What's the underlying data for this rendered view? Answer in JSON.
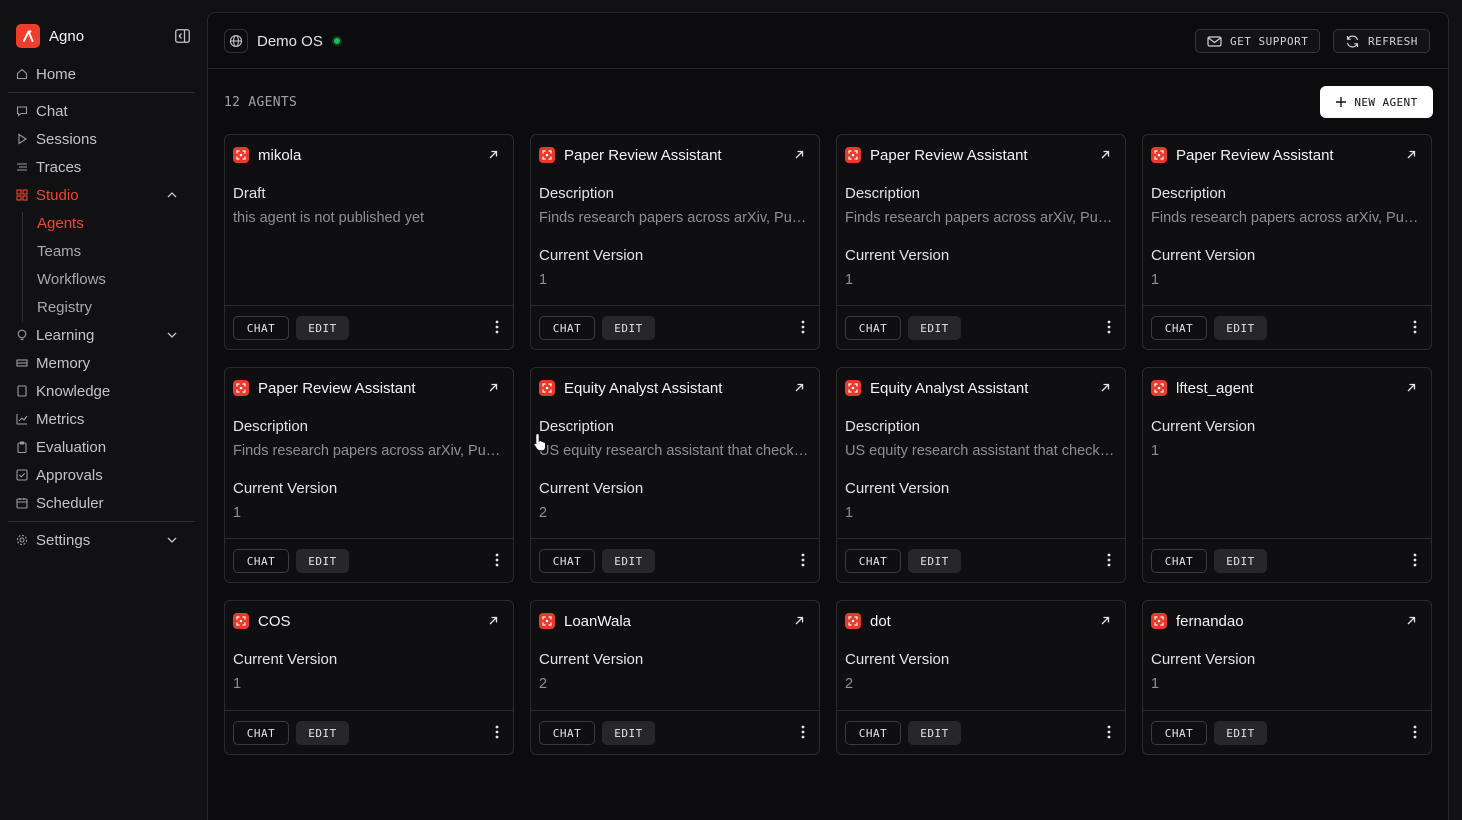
{
  "sidebar": {
    "brand": "Agno",
    "nav": {
      "home": "Home",
      "chat": "Chat",
      "sessions": "Sessions",
      "traces": "Traces",
      "studio": "Studio",
      "agents": "Agents",
      "teams": "Teams",
      "workflows": "Workflows",
      "registry": "Registry",
      "learning": "Learning",
      "memory": "Memory",
      "knowledge": "Knowledge",
      "metrics": "Metrics",
      "evaluation": "Evaluation",
      "approvals": "Approvals",
      "scheduler": "Scheduler",
      "settings": "Settings"
    }
  },
  "header": {
    "os_name": "Demo OS",
    "status_color": "#1db954",
    "support_label": "GET SUPPORT",
    "refresh_label": "REFRESH"
  },
  "main": {
    "count_label": "12 AGENTS",
    "new_agent_label": "NEW AGENT"
  },
  "labels": {
    "chat": "CHAT",
    "edit": "EDIT"
  },
  "agents": [
    {
      "name": "mikola",
      "f1_label": "Draft",
      "f1_value": "this agent is not published yet"
    },
    {
      "name": "Paper Review Assistant",
      "f1_label": "Description",
      "f1_value": "Finds research papers across arXiv, PubMed, and other sources",
      "f2_label": "Current Version",
      "f2_value": "1"
    },
    {
      "name": "Paper Review Assistant",
      "f1_label": "Description",
      "f1_value": "Finds research papers across arXiv, PubMed, and other sources",
      "f2_label": "Current Version",
      "f2_value": "1"
    },
    {
      "name": "Paper Review Assistant",
      "f1_label": "Description",
      "f1_value": "Finds research papers across arXiv, PubMed, and other sources",
      "f2_label": "Current Version",
      "f2_value": "1"
    },
    {
      "name": "Paper Review Assistant",
      "f1_label": "Description",
      "f1_value": "Finds research papers across arXiv, PubMed, and other sources",
      "f2_label": "Current Version",
      "f2_value": "1"
    },
    {
      "name": "Equity Analyst Assistant",
      "f1_label": "Description",
      "f1_value": "US equity research assistant that checks filings and prices",
      "f2_label": "Current Version",
      "f2_value": "2"
    },
    {
      "name": "Equity Analyst Assistant",
      "f1_label": "Description",
      "f1_value": "US equity research assistant that checks filings and prices",
      "f2_label": "Current Version",
      "f2_value": "1"
    },
    {
      "name": "lftest_agent",
      "f1_label": "Current Version",
      "f1_value": "1"
    },
    {
      "name": "COS",
      "f1_label": "Current Version",
      "f1_value": "1"
    },
    {
      "name": "LoanWala",
      "f1_label": "Current Version",
      "f1_value": "2"
    },
    {
      "name": "dot",
      "f1_label": "Current Version",
      "f1_value": "2"
    },
    {
      "name": "fernandao",
      "f1_label": "Current Version",
      "f1_value": "1"
    }
  ]
}
